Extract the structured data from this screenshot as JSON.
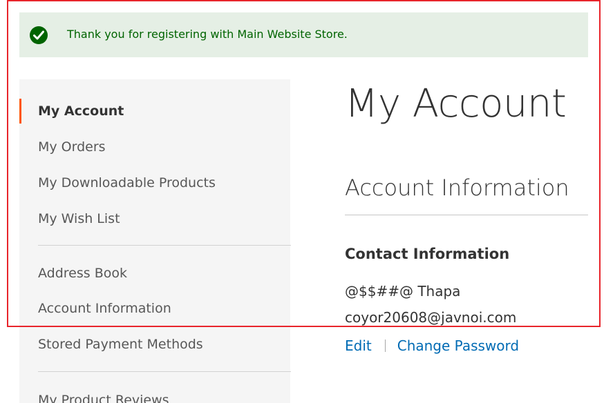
{
  "message": {
    "text": "Thank you for registering with Main Website Store.",
    "icon": "check-circle-icon",
    "color": "#006400",
    "background": "#e5efe5"
  },
  "sidebar": {
    "items": [
      {
        "label": "My Account",
        "current": true
      },
      {
        "label": "My Orders"
      },
      {
        "label": "My Downloadable Products"
      },
      {
        "label": "My Wish List"
      },
      {
        "label": "Address Book"
      },
      {
        "label": "Account Information"
      },
      {
        "label": "Stored Payment Methods"
      },
      {
        "label": "My Product Reviews"
      }
    ],
    "accent_color": "#ff5501"
  },
  "main": {
    "page_title": "My Account",
    "section_title": "Account Information",
    "contact": {
      "title": "Contact Information",
      "name": "@$$##@ Thapa",
      "email": "coyor20608@javnoi.com"
    },
    "actions": {
      "edit": "Edit",
      "change_password": "Change Password"
    },
    "link_color": "#006bb4"
  },
  "highlight_color": "#e8242b"
}
